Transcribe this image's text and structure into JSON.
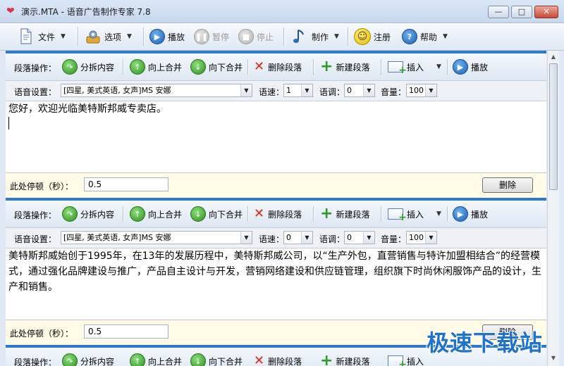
{
  "window": {
    "title": "演示.MTA - 语音广告制作专家 7.8",
    "controls": {
      "minimize": "—",
      "maximize": "□",
      "close": "✕"
    }
  },
  "toolbar": {
    "file": "文件",
    "options": "选项",
    "play": "播放",
    "pause": "暂停",
    "stop": "停止",
    "produce": "制作",
    "register": "注册",
    "help": "帮助"
  },
  "paragraph_tools": {
    "label": "段落操作：",
    "split": "分拆内容",
    "merge_up": "向上合并",
    "merge_down": "向下合并",
    "delete_para": "删除段落",
    "new_para": "新建段落",
    "insert": "插入",
    "play": "播放"
  },
  "voice_labels": {
    "voice": "语音设置：",
    "speed": "语速：",
    "pitch": "语调：",
    "volume": "音量："
  },
  "pause_labels": {
    "label": "此处停顿（秒）：",
    "delete": "删除"
  },
  "paragraphs": [
    {
      "voice": "[四星, 美式英语, 女声]MS 安娜",
      "speed": "1",
      "pitch": "0",
      "volume": "100",
      "text": "您好，欢迎光临美特斯邦威专卖店。",
      "pause": "0.5"
    },
    {
      "voice": "[四星, 美式英语, 女声]MS 安娜",
      "speed": "0",
      "pitch": "0",
      "volume": "100",
      "text": "美特斯邦威始创于1995年，在13年的发展历程中，美特斯邦威公司，以“生产外包，直营销售与特许加盟相结合”的经营模式，通过强化品牌建设与推广，产品自主设计与开发，营销网络建设和供应链管理，组织旗下时尚休闲服饰产品的设计，生产和销售。",
      "pause": "0.5"
    },
    {
      "voice": "",
      "speed": "",
      "pitch": "",
      "volume": "",
      "text": "",
      "pause": ""
    }
  ],
  "watermark": "极速下载站",
  "colors": {
    "accent": "#2e79c9",
    "pause_row_bg": "#fffbe6",
    "delete_icon": "#e1261c",
    "add_icon": "#2f9a2a"
  }
}
